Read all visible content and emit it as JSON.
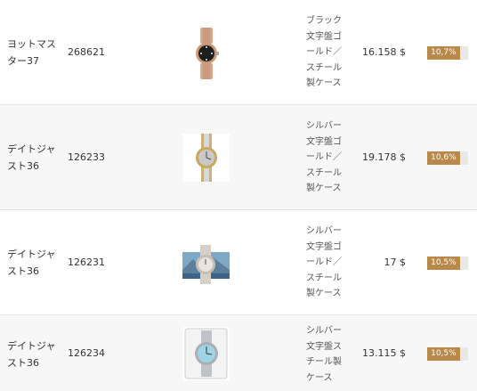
{
  "rows": [
    {
      "model": "ヨットマスター37",
      "reference": "268621",
      "description": "ブラック文字盤ゴールド／スチール製ケース",
      "price": "16.158 $",
      "change_label": "10,7%",
      "change_fraction": 0.8,
      "photo_icon": "two-tone-watch-black-dial-icon"
    },
    {
      "model": "デイトジャスト36",
      "reference": "126233",
      "description": "シルバー文字盤ゴールド／スチール製ケース",
      "price": "19.178 $",
      "change_label": "10,6%",
      "change_fraction": 0.8,
      "photo_icon": "two-tone-watch-silver-dial-icon"
    },
    {
      "model": "デイトジャスト36",
      "reference": "126231",
      "description": "シルバー文字盤ゴールド／スチール製ケース",
      "price": "17 $",
      "change_label": "10,5%",
      "change_fraction": 0.8,
      "photo_icon": "watch-mountain-background-icon"
    },
    {
      "model": "デイトジャスト36",
      "reference": "126234",
      "description": "シルバー文字盤スチール製ケース",
      "price": "13.115 $",
      "change_label": "10,5%",
      "change_fraction": 0.8,
      "photo_icon": "steel-watch-in-box-icon"
    }
  ]
}
